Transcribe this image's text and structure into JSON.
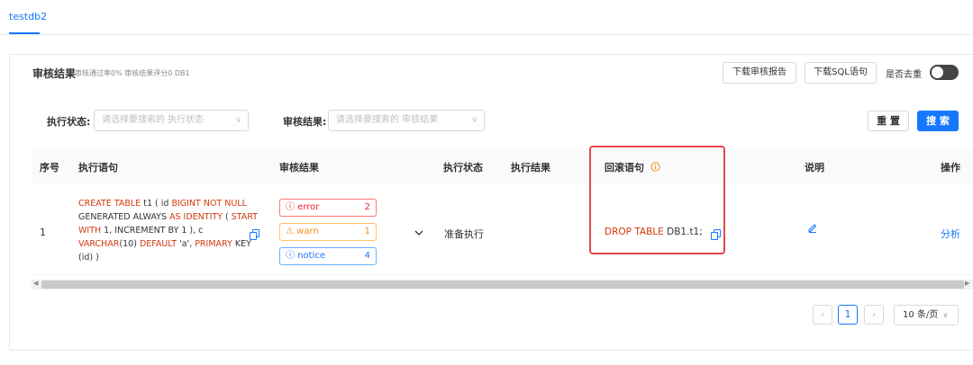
{
  "tab": {
    "label": "testdb2"
  },
  "result": {
    "title": "审核结果",
    "meta": "审核通过率0%  审核结果评分0  DB1",
    "download_report": "下载审核报告",
    "download_sql": "下载SQL语句",
    "dedup_label": "是否去重",
    "dedup_on": false
  },
  "filters": {
    "exec_status_label": "执行状态:",
    "exec_status_placeholder": "请选择要搜索的 执行状态",
    "audit_result_label": "审核结果:",
    "audit_result_placeholder": "请选择要搜索的 审核结果",
    "reset": "重 置",
    "search": "搜 索"
  },
  "table": {
    "headers": [
      "序号",
      "执行语句",
      "审核结果",
      "执行状态",
      "执行结果",
      "回滚语句",
      "说明",
      "操作"
    ],
    "rows": [
      {
        "index": "1",
        "sql_parts": [
          [
            "CREATE TABLE",
            true
          ],
          [
            " t1 ( id ",
            false
          ],
          [
            "BIGINT NOT NULL",
            true
          ],
          [
            " GENERATED ALWAYS ",
            false
          ],
          [
            "AS IDENTITY",
            true
          ],
          [
            " ( ",
            false
          ],
          [
            "START WITH",
            true
          ],
          [
            " 1, INCREMENT BY 1 ), c ",
            false
          ],
          [
            "VARCHAR",
            true
          ],
          [
            "(10) ",
            false
          ],
          [
            "DEFAULT",
            true
          ],
          [
            " 'a', ",
            false
          ],
          [
            "PRIMARY",
            true
          ],
          [
            " KEY (id) )",
            false
          ]
        ],
        "tags": {
          "error_label": "error",
          "error_count": "2",
          "warn_label": "warn",
          "warn_count": "1",
          "notice_label": "notice",
          "notice_count": "4"
        },
        "exec_status": "准备执行",
        "exec_result": "",
        "rollback_keyword": "DROP TABLE",
        "rollback_rest": " DB1.t1;",
        "action": "分析"
      }
    ]
  },
  "pagination": {
    "current": "1",
    "page_size": "10 条/页"
  },
  "colors": {
    "accent": "#1677ff",
    "keyword": "#d4380d",
    "error": "#f5222d",
    "warn": "#fa8c16",
    "highlight": "#e5484d"
  }
}
